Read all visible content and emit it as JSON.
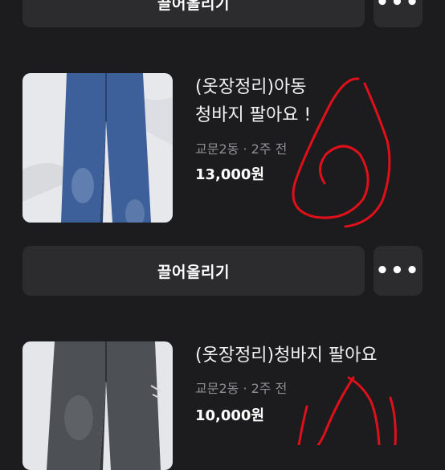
{
  "listings": [
    {
      "title": "(옷장정리)아동\n청바지 팔아요 !",
      "location": "교문2동",
      "time": "2주 전",
      "price": "13,000원"
    },
    {
      "title": "(옷장정리)청바지 팔아요",
      "location": "교문2동",
      "time": "2주 전",
      "price": "10,000원"
    }
  ],
  "bump_label": "끌어올리기",
  "more_label": "•••",
  "separator": "·",
  "annotation_color": "#e0101a",
  "icons": {
    "more": "more-dots-icon"
  }
}
